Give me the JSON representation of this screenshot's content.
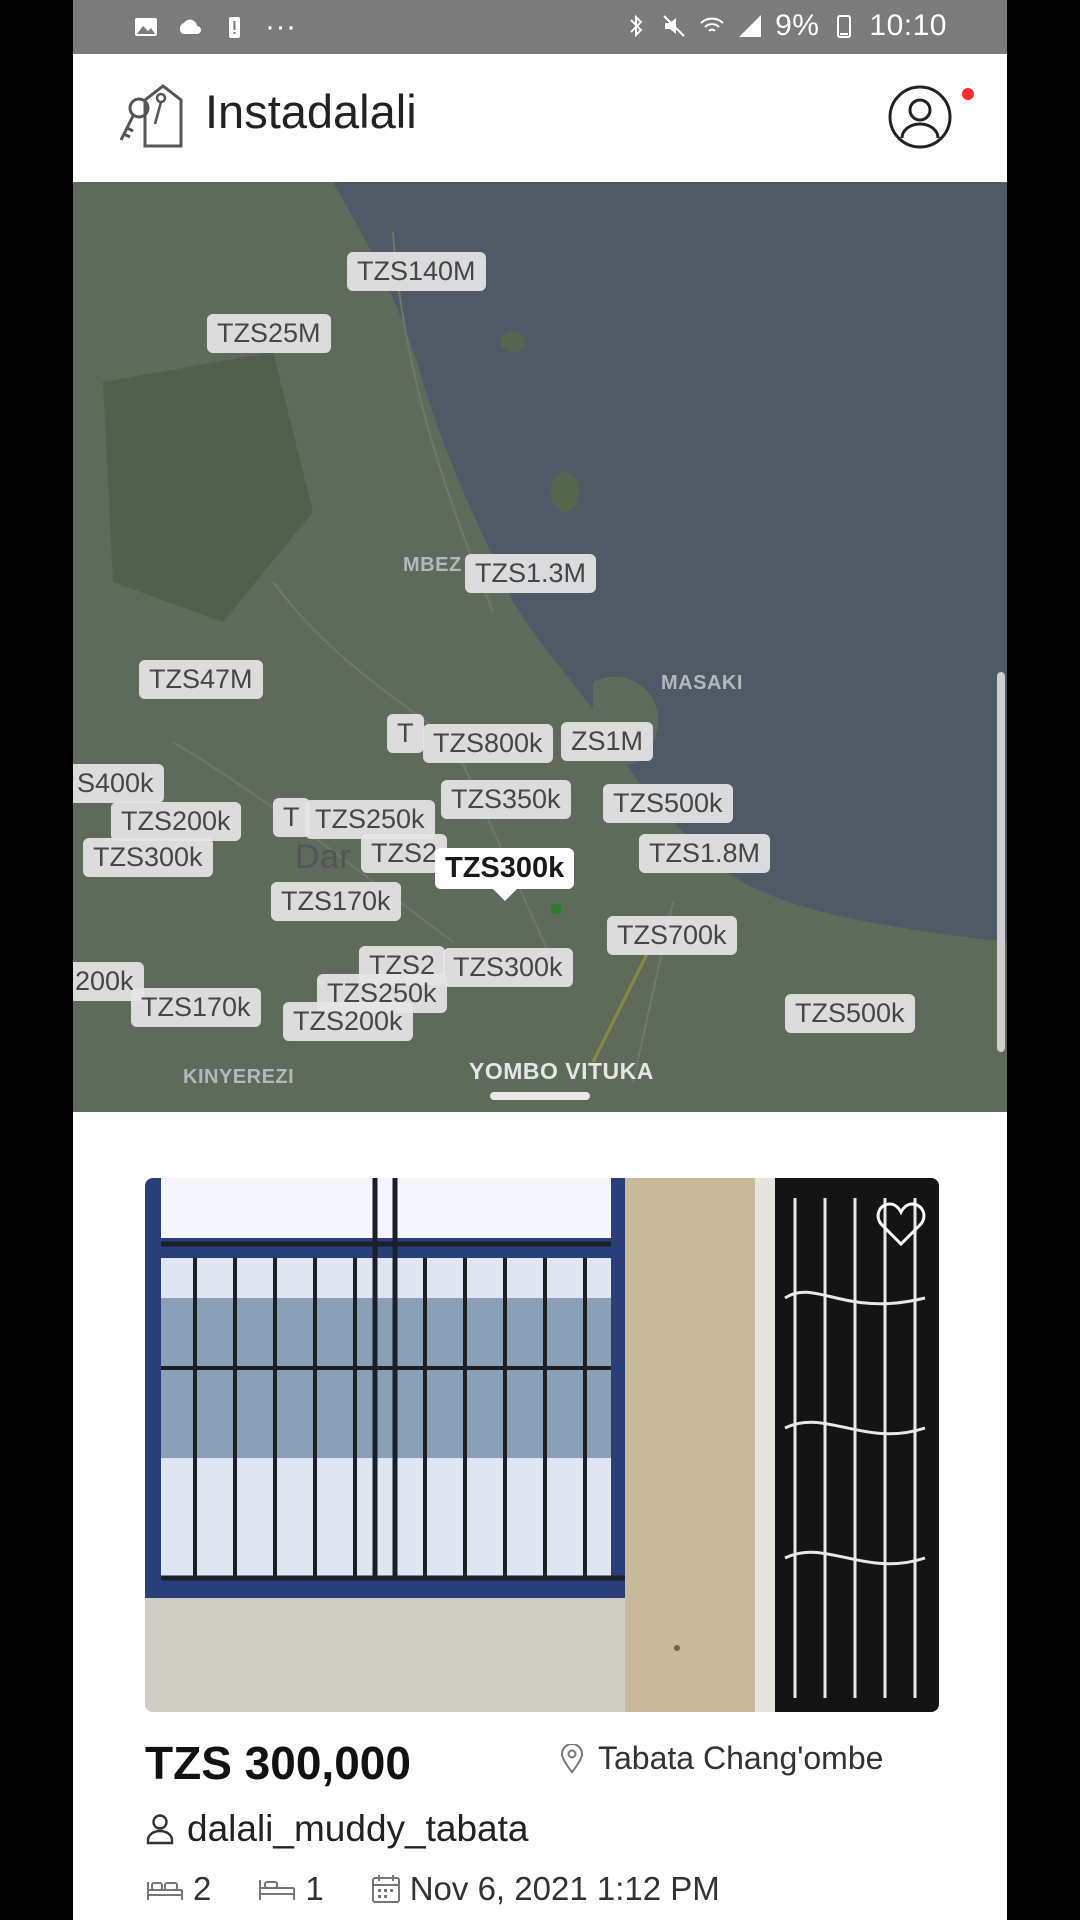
{
  "status_bar": {
    "battery": "9%",
    "time": "10:10"
  },
  "app": {
    "title": "Instadalali"
  },
  "map": {
    "area_labels": [
      "MBEZ",
      "MASAKI",
      "Dar",
      "YOMBO VITUKA",
      "KINYEREZI"
    ],
    "price_tags": [
      {
        "label": "TZS140M"
      },
      {
        "label": "TZS25M"
      },
      {
        "label": "TZS1.3M"
      },
      {
        "label": "TZS47M"
      },
      {
        "label": "T"
      },
      {
        "label": "TZS800k"
      },
      {
        "label": "ZS1M"
      },
      {
        "label": "S400k"
      },
      {
        "label": "TZS200k"
      },
      {
        "label": "T"
      },
      {
        "label": "TZS250k"
      },
      {
        "label": "TZS350k"
      },
      {
        "label": "TZS500k"
      },
      {
        "label": "TZS300k"
      },
      {
        "label": "TZS2"
      },
      {
        "label": "TZS1.8M"
      },
      {
        "label": "TZS170k"
      },
      {
        "label": "TZS300k",
        "selected": true
      },
      {
        "label": "TZS700k"
      },
      {
        "label": "200k"
      },
      {
        "label": "TZS2"
      },
      {
        "label": "TZS300k"
      },
      {
        "label": "TZS170k"
      },
      {
        "label": "TZS250k"
      },
      {
        "label": "TZS200k"
      },
      {
        "label": "TZS500k"
      }
    ]
  },
  "listing": {
    "price": "TZS 300,000",
    "location": "Tabata Chang'ombe",
    "agent": "dalali_muddy_tabata",
    "bedrooms": "2",
    "beds": "1",
    "date": "Nov 6, 2021 1:12 PM",
    "favorited": false
  },
  "colors": {
    "status_bar": "#7b7b7b",
    "map_water": "#4f5a66",
    "map_land": "#5e6b5a",
    "notification": "#ff2a2a"
  },
  "icons": [
    "gallery-icon",
    "cloud-icon",
    "battery-alert-icon",
    "more-icon",
    "bluetooth-icon",
    "mute-icon",
    "wifi-call-icon",
    "signal-icon",
    "battery-icon",
    "key-house-logo-icon",
    "profile-icon",
    "heart-icon",
    "location-pin-icon",
    "person-icon",
    "bed-icon",
    "calendar-icon"
  ]
}
